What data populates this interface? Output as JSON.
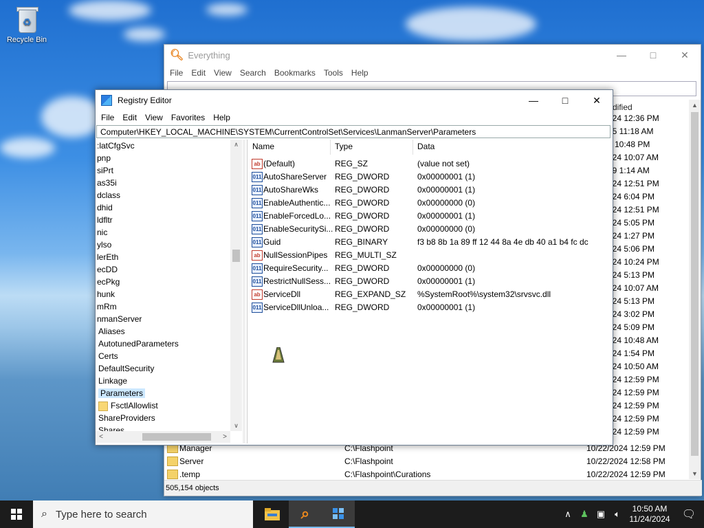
{
  "desktop": {
    "recycle_bin_label": "Recycle Bin"
  },
  "everything": {
    "title": "Everything",
    "menu": [
      "File",
      "Edit",
      "View",
      "Search",
      "Bookmarks",
      "Tools",
      "Help"
    ],
    "col_modified_partial": "dified",
    "dates": [
      "024 12:36 PM",
      "15 11:18 AM",
      "5 10:48 PM",
      "024 10:07 AM",
      "19 1:14 AM",
      "024 12:51 PM",
      "024 6:04 PM",
      "024 12:51 PM",
      "024 5:05 PM",
      "024 1:27 PM",
      "024 5:06 PM",
      "024 10:24 PM",
      "024 5:13 PM",
      "024 10:07 AM",
      "024 5:13 PM",
      "024 3:02 PM",
      "024 5:09 PM",
      "024 10:48 AM",
      "024 1:54 PM",
      "024 10:50 AM",
      "024 12:59 PM",
      "024 12:59 PM",
      "024 12:59 PM",
      "024 12:59 PM",
      "024 12:59 PM"
    ],
    "rows": [
      {
        "name": "Manager",
        "path": "C:\\Flashpoint",
        "date": "10/22/2024 12:59 PM"
      },
      {
        "name": "Server",
        "path": "C:\\Flashpoint",
        "date": "10/22/2024 12:58 PM"
      },
      {
        "name": ".temp",
        "path": "C:\\Flashpoint\\Curations",
        "date": "10/22/2024 12:59 PM"
      }
    ],
    "status": "505,154 objects"
  },
  "registry": {
    "title": "Registry Editor",
    "menu": [
      "File",
      "Edit",
      "View",
      "Favorites",
      "Help"
    ],
    "address": "Computer\\HKEY_LOCAL_MACHINE\\SYSTEM\\CurrentControlSet\\Services\\LanmanServer\\Parameters",
    "tree": [
      ":latCfgSvc",
      "pnp",
      "siPrt",
      "as35i",
      "dclass",
      "dhid",
      "ldfltr",
      "nic",
      "ylso",
      "lerEth",
      "ecDD",
      "ecPkg",
      "hunk",
      "mRm",
      "nmanServer",
      "Aliases",
      "AutotunedParameters",
      "Certs",
      "DefaultSecurity",
      "Linkage",
      "Parameters",
      "FsctlAllowlist",
      "ShareProviders",
      "Shares"
    ],
    "headers": {
      "name": "Name",
      "type": "Type",
      "data": "Data"
    },
    "values": [
      {
        "icon": "ab",
        "name": "(Default)",
        "type": "REG_SZ",
        "data": "(value not set)"
      },
      {
        "icon": "bin",
        "name": "AutoShareServer",
        "type": "REG_DWORD",
        "data": "0x00000001 (1)"
      },
      {
        "icon": "bin",
        "name": "AutoShareWks",
        "type": "REG_DWORD",
        "data": "0x00000001 (1)"
      },
      {
        "icon": "bin",
        "name": "EnableAuthentic...",
        "type": "REG_DWORD",
        "data": "0x00000000 (0)"
      },
      {
        "icon": "bin",
        "name": "EnableForcedLo...",
        "type": "REG_DWORD",
        "data": "0x00000001 (1)"
      },
      {
        "icon": "bin",
        "name": "EnableSecuritySi...",
        "type": "REG_DWORD",
        "data": "0x00000000 (0)"
      },
      {
        "icon": "bin",
        "name": "Guid",
        "type": "REG_BINARY",
        "data": "f3 b8 8b 1a 89 ff 12 44 8a 4e db 40 a1 b4 fc dc"
      },
      {
        "icon": "ab",
        "name": "NullSessionPipes",
        "type": "REG_MULTI_SZ",
        "data": ""
      },
      {
        "icon": "bin",
        "name": "RequireSecurity...",
        "type": "REG_DWORD",
        "data": "0x00000000 (0)"
      },
      {
        "icon": "bin",
        "name": "RestrictNullSess...",
        "type": "REG_DWORD",
        "data": "0x00000001 (1)"
      },
      {
        "icon": "ab",
        "name": "ServiceDll",
        "type": "REG_EXPAND_SZ",
        "data": "%SystemRoot%\\system32\\srvsvc.dll"
      },
      {
        "icon": "bin",
        "name": "ServiceDllUnloa...",
        "type": "REG_DWORD",
        "data": "0x00000001 (1)"
      }
    ]
  },
  "taskbar": {
    "search_placeholder": "Type here to search",
    "time": "10:50 AM",
    "date": "11/24/2024"
  },
  "colors": {
    "accent": "#76b9ed",
    "selection": "#cce8ff",
    "taskbar": "#1c1c1c"
  }
}
